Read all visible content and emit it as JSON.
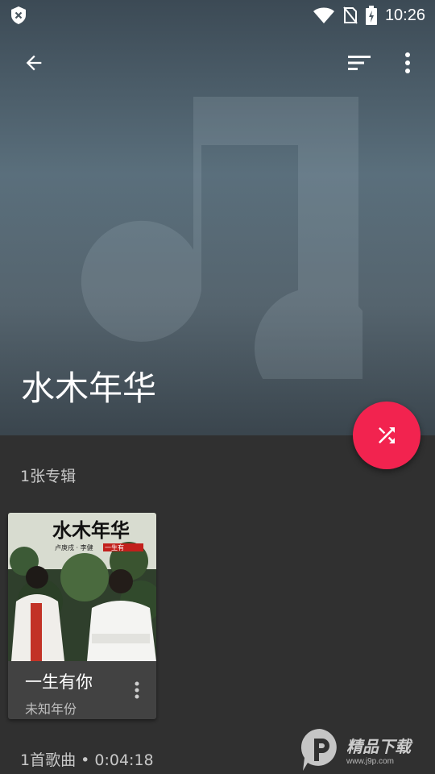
{
  "status_bar": {
    "time": "10:26",
    "icons": [
      "shield-x-icon",
      "wifi-icon",
      "no-sim-icon",
      "battery-charging-icon"
    ]
  },
  "toolbar": {
    "back_icon": "arrow-back-icon",
    "sort_icon": "sort-icon",
    "more_icon": "more-vert-icon"
  },
  "artist": {
    "name": "水木年华",
    "header_icon": "music-note-icon"
  },
  "fab": {
    "icon": "shuffle-icon",
    "color": "#f2234f"
  },
  "albums_section": {
    "count_label": "1张专辑",
    "albums": [
      {
        "title": "一生有你",
        "year": "未知年份",
        "cover_text": "水木年华",
        "cover_subtext": "卢庚戌 · 李健",
        "cover_tag": "一生有",
        "more_icon": "more-vert-icon"
      }
    ]
  },
  "songs_section": {
    "summary": "1首歌曲 • 0:04:18"
  },
  "watermark": {
    "text": "精品下载",
    "url": "www.j9p.com"
  },
  "colors": {
    "background": "#303030",
    "card": "#424242",
    "accent": "#f2234f"
  }
}
